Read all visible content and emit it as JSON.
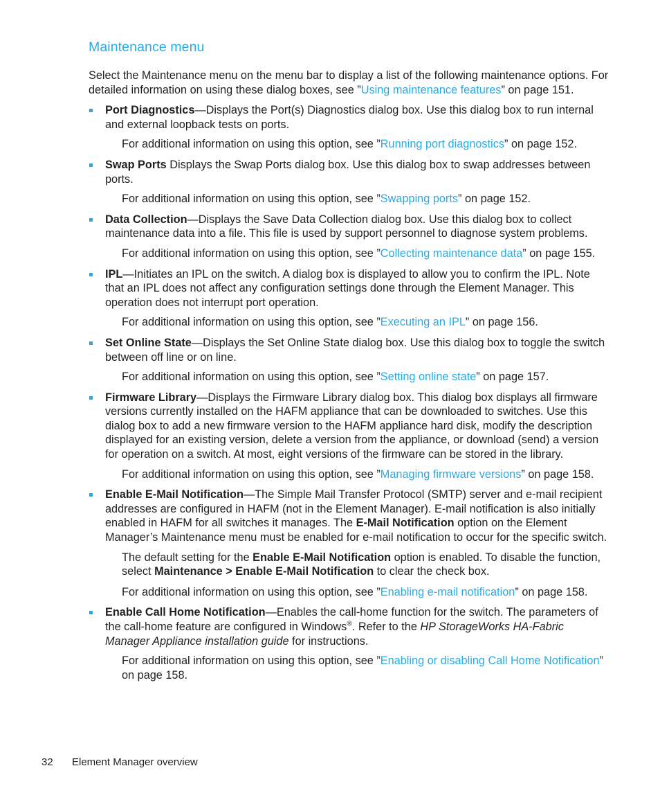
{
  "document": {
    "heading": "Maintenance menu",
    "intro": {
      "part1": "Select the Maintenance menu on the menu bar to display a list of the following maintenance options. For detailed information on using these dialog boxes, see ”",
      "link": "Using maintenance features",
      "part2": "” on page 151."
    },
    "options": [
      {
        "term": "Port Diagnostics",
        "separator": "—",
        "description": "Displays the Port(s) Diagnostics dialog box. Use this dialog box to run internal and external loopback tests on ports.",
        "xref_prefix": "For additional information on using this option, see ”",
        "xref_link": "Running port diagnostics",
        "xref_suffix": "” on page 152."
      },
      {
        "term": "Swap Ports",
        "separator": "  ",
        "description": "Displays the Swap Ports dialog box. Use this dialog box to swap addresses between ports.",
        "xref_prefix": "For additional information on using this option, see ”",
        "xref_link": "Swapping ports",
        "xref_suffix": "” on page 152."
      },
      {
        "term": "Data Collection",
        "separator": "—",
        "description": "Displays the Save Data Collection dialog box. Use this dialog box to collect maintenance data into a file. This file is used by support personnel to diagnose system problems.",
        "xref_prefix": "For additional information on using this option, see ”",
        "xref_link": "Collecting maintenance data",
        "xref_suffix": "” on page 155."
      },
      {
        "term": "IPL",
        "separator": "—",
        "description": "Initiates an IPL on the switch. A dialog box is displayed to allow you to confirm the IPL. Note that an IPL does not affect any configuration settings done through the Element Manager. This operation does not interrupt port operation.",
        "xref_prefix": "For additional information on using this option, see ”",
        "xref_link": "Executing an IPL",
        "xref_suffix": "” on page 156."
      },
      {
        "term": "Set Online State",
        "separator": "—",
        "description": "Displays the Set Online State dialog box. Use this dialog box to toggle the switch between off line or on line.",
        "xref_prefix": "For additional information on using this option, see ”",
        "xref_link": "Setting online state",
        "xref_suffix": "” on page 157."
      },
      {
        "term": "Firmware Library",
        "separator": "—",
        "description": "Displays the Firmware Library dialog box. This dialog box displays all firmware versions currently installed on the HAFM appliance that can be downloaded to switches. Use this dialog box to add a new firmware version to the HAFM appliance hard disk, modify the description displayed for an existing version, delete a version from the appliance, or download (send) a version for operation on a switch. At most, eight versions of the firmware can be stored in the library.",
        "xref_prefix": "For additional information on using this option, see ”",
        "xref_link": "Managing firmware versions",
        "xref_suffix": "” on page 158."
      },
      {
        "term": "Enable E-Mail Notification",
        "separator": "—",
        "desc_a": "The Simple Mail Transfer Protocol (SMTP) server and e-mail recipient addresses are configured in HAFM (not in the Element Manager). E-mail notification is also initially enabled in HAFM for all switches it manages. The ",
        "desc_bold": "E-Mail Notification",
        "desc_b": " option on the Element Manager’s Maintenance menu must be enabled for e-mail notification to occur for the specific switch.",
        "default_a": "The default setting for the ",
        "default_bold1": "Enable E-Mail Notification",
        "default_b": " option is enabled. To disable the function, select ",
        "default_bold2": "Maintenance > Enable E-Mail Notification",
        "default_c": " to clear the check box.",
        "xref_prefix": "For additional information on using this option, see ”",
        "xref_link": "Enabling e-mail notification",
        "xref_suffix": "” on page 158."
      },
      {
        "term": "Enable Call Home Notification",
        "separator": "—",
        "desc_a": "Enables the call-home function for the switch. The parameters of the call-home feature are configured in Windows",
        "desc_sup": "®",
        "desc_b": ". Refer to the ",
        "desc_italic": "HP StorageWorks HA-Fabric Manager Appliance installation guide",
        "desc_c": " for instructions.",
        "xref_prefix": "For additional information on using this option, see ”",
        "xref_link": "Enabling or disabling Call Home Notification",
        "xref_suffix": "” on page 158."
      }
    ],
    "footer": {
      "page_number": "32",
      "title": "Element Manager overview"
    },
    "colors": {
      "accent": "#29abe2",
      "text": "#231f20",
      "background": "#ffffff"
    }
  }
}
